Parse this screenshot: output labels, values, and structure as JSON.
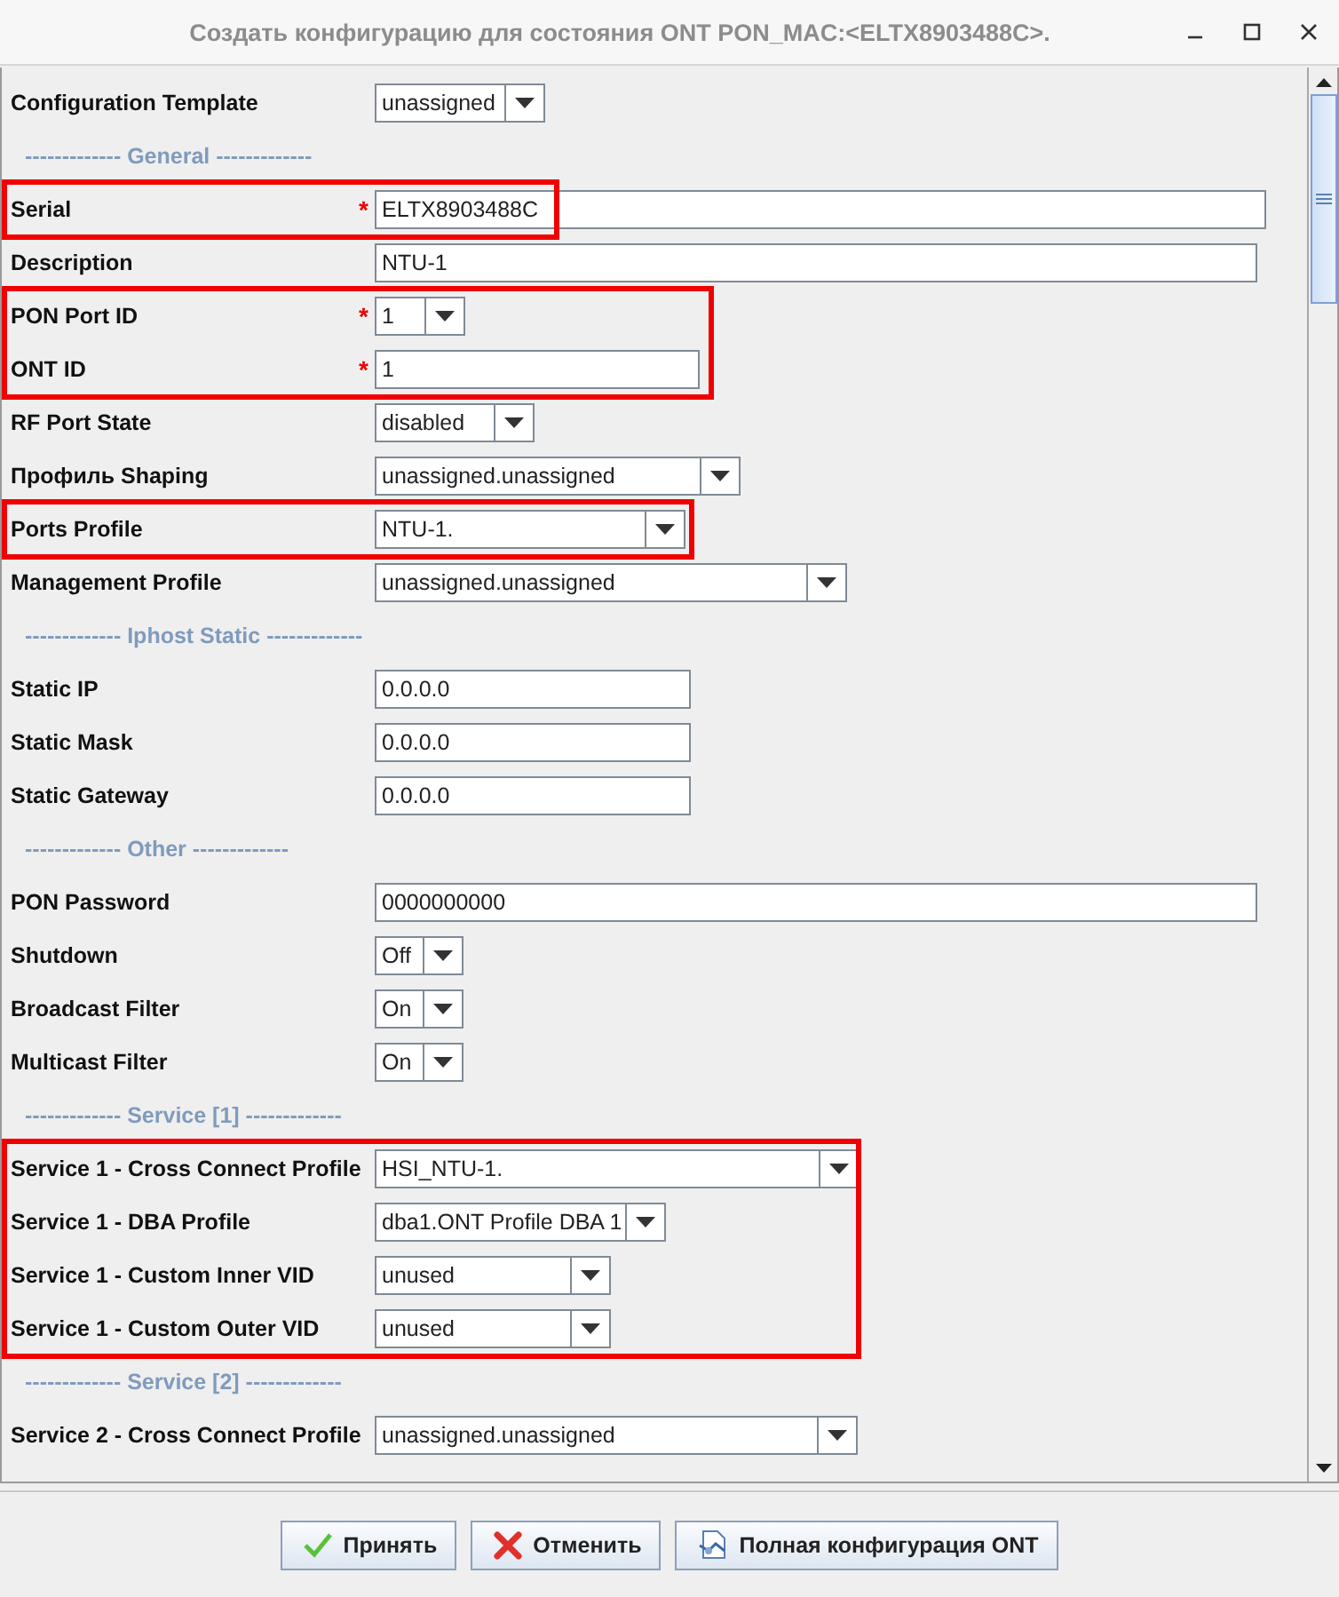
{
  "window": {
    "title": "Создать конфигурацию для состояния ONT PON_MAC:<ELTX8903488C>."
  },
  "groups": [
    {
      "kind": "row",
      "highlighted": false,
      "rows": [
        {
          "kind": "combo",
          "label": "Configuration Template",
          "value": "unassigned"
        }
      ]
    },
    {
      "kind": "section",
      "title": "------------- General -------------"
    },
    {
      "kind": "row",
      "highlighted": true,
      "rows": [
        {
          "kind": "text",
          "label": "Serial",
          "marker": "*",
          "value": "ELTX8903488C"
        }
      ]
    },
    {
      "kind": "row",
      "highlighted": false,
      "rows": [
        {
          "kind": "text",
          "label": "Description",
          "value": "NTU-1"
        }
      ]
    },
    {
      "kind": "row",
      "highlighted": true,
      "rows": [
        {
          "kind": "combo",
          "label": "PON Port ID",
          "marker": "*",
          "value": "1"
        },
        {
          "kind": "text",
          "label": "ONT ID",
          "marker": "*",
          "value": "1"
        }
      ]
    },
    {
      "kind": "row",
      "highlighted": false,
      "rows": [
        {
          "kind": "combo",
          "label": "RF Port State",
          "value": "disabled"
        },
        {
          "kind": "combo",
          "label": "Профиль Shaping",
          "value": "unassigned.unassigned"
        }
      ]
    },
    {
      "kind": "row",
      "highlighted": true,
      "rows": [
        {
          "kind": "combo",
          "label": "Ports Profile",
          "value": "NTU-1."
        }
      ]
    },
    {
      "kind": "row",
      "highlighted": false,
      "rows": [
        {
          "kind": "combo",
          "label": "Management Profile",
          "value": "unassigned.unassigned"
        }
      ]
    },
    {
      "kind": "section",
      "title": "------------- Iphost Static -------------"
    },
    {
      "kind": "row",
      "highlighted": false,
      "rows": [
        {
          "kind": "text",
          "label": "Static IP",
          "value": "0.0.0.0"
        },
        {
          "kind": "text",
          "label": "Static Mask",
          "value": "0.0.0.0"
        },
        {
          "kind": "text",
          "label": "Static Gateway",
          "value": "0.0.0.0"
        }
      ]
    },
    {
      "kind": "section",
      "title": "------------- Other -------------"
    },
    {
      "kind": "row",
      "highlighted": false,
      "rows": [
        {
          "kind": "text",
          "label": "PON Password",
          "value": "0000000000"
        },
        {
          "kind": "combo",
          "label": "Shutdown",
          "value": "Off"
        },
        {
          "kind": "combo",
          "label": "Broadcast Filter",
          "value": "On"
        },
        {
          "kind": "combo",
          "label": "Multicast Filter",
          "value": "On"
        }
      ]
    },
    {
      "kind": "section",
      "title": "------------- Service [1] -------------"
    },
    {
      "kind": "row",
      "highlighted": true,
      "rows": [
        {
          "kind": "combo",
          "label": "Service 1 - Cross Connect Profile",
          "value": "HSI_NTU-1."
        },
        {
          "kind": "combo",
          "label": "Service 1 - DBA Profile",
          "value": "dba1.ONT Profile DBA 1"
        },
        {
          "kind": "combo",
          "label": "Service 1 - Custom Inner VID",
          "value": "unused"
        },
        {
          "kind": "combo",
          "label": "Service 1 - Custom Outer VID",
          "value": "unused"
        }
      ]
    },
    {
      "kind": "section",
      "title": "------------- Service [2] -------------"
    },
    {
      "kind": "row",
      "highlighted": false,
      "rows": [
        {
          "kind": "combo",
          "label": "Service 2 - Cross Connect Profile",
          "value": "unassigned.unassigned"
        }
      ]
    }
  ],
  "buttons": [
    {
      "kind": "accept",
      "label": "Принять"
    },
    {
      "kind": "cancel",
      "label": "Отменить"
    },
    {
      "kind": "config",
      "label": "Полная конфигурация ONT"
    }
  ]
}
